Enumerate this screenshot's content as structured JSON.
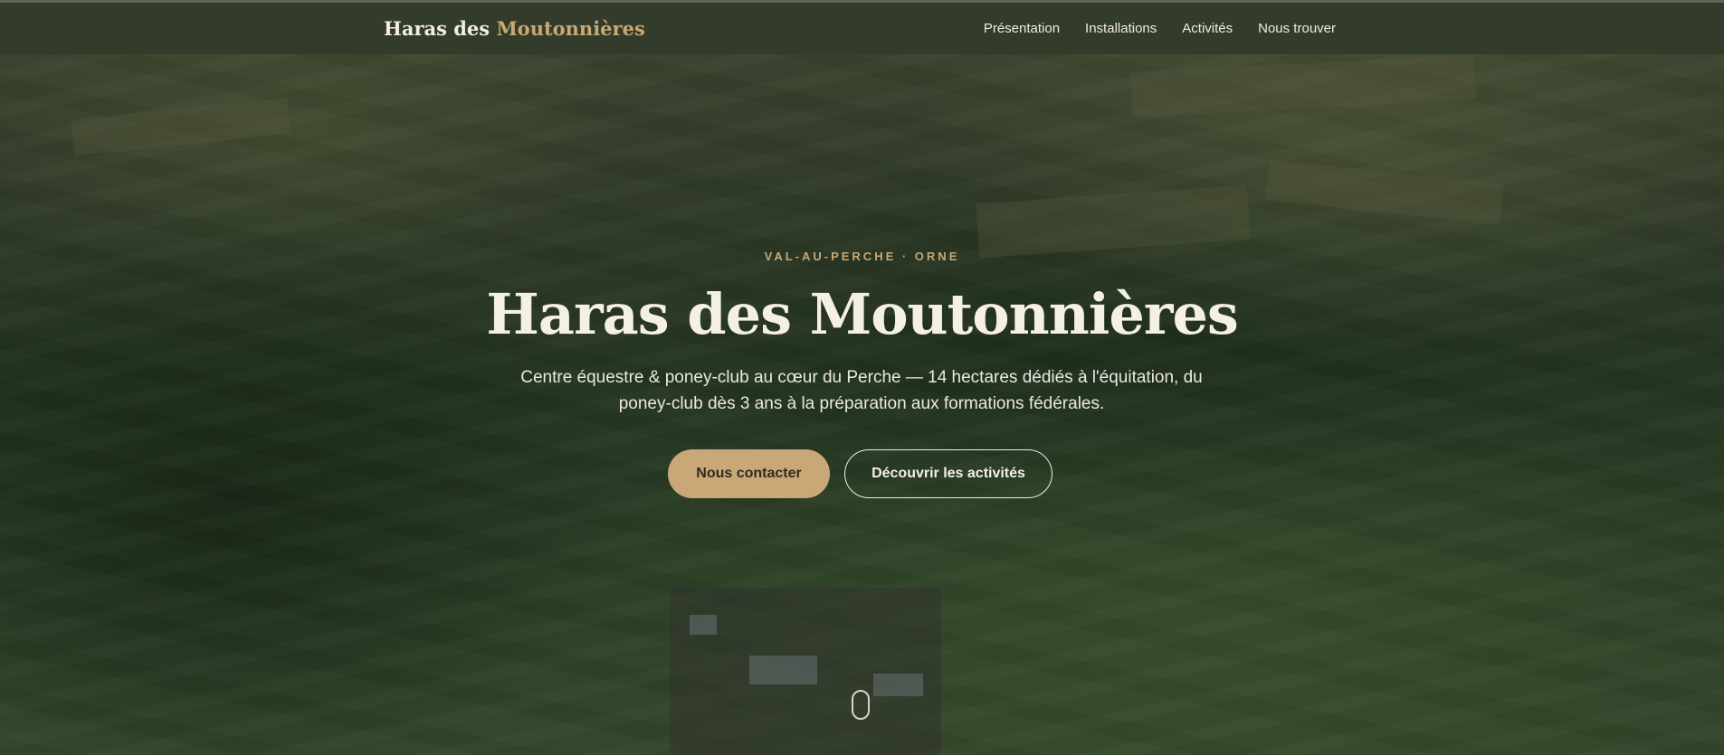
{
  "header": {
    "brand_main": "Haras des ",
    "brand_accent": "Moutonnières",
    "nav": [
      "Présentation",
      "Installations",
      "Activités",
      "Nous trouver"
    ]
  },
  "hero": {
    "eyebrow": "VAL-AU-PERCHE · ORNE",
    "title": "Haras des Moutonnières",
    "description": "Centre équestre & poney-club au cœur du Perche — 14 hectares dédiés à l'équitation, du poney-club dès 3 ans à la préparation aux formations fédérales.",
    "primary_cta": "Nous contacter",
    "secondary_cta": "Découvrir les activités",
    "scroll_icon": "mouse-scroll-icon"
  },
  "colors": {
    "accent": "#c8a874",
    "header_bg": "#333c2b",
    "text_light": "#f5f0e6"
  }
}
